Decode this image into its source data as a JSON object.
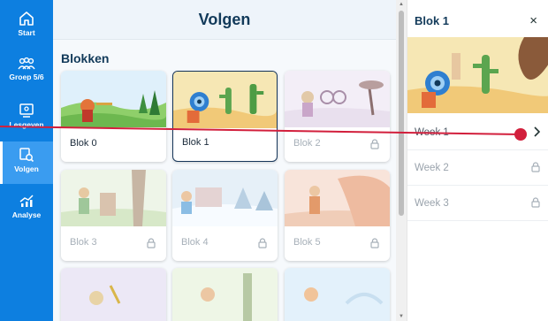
{
  "sidebar": {
    "items": [
      {
        "label": "Start",
        "icon": "home-icon"
      },
      {
        "label": "Groep 5/6",
        "icon": "group-icon"
      },
      {
        "label": "Lesgeven",
        "icon": "teach-icon"
      },
      {
        "label": "Volgen",
        "icon": "track-icon",
        "active": true
      },
      {
        "label": "Analyse",
        "icon": "chart-icon"
      }
    ]
  },
  "main": {
    "title": "Volgen",
    "section_title": "Blokken",
    "blocks": [
      {
        "label": "Blok 0",
        "locked": false,
        "selected": false
      },
      {
        "label": "Blok 1",
        "locked": false,
        "selected": true
      },
      {
        "label": "Blok 2",
        "locked": true,
        "selected": false
      },
      {
        "label": "Blok 3",
        "locked": true,
        "selected": false
      },
      {
        "label": "Blok 4",
        "locked": true,
        "selected": false
      },
      {
        "label": "Blok 5",
        "locked": true,
        "selected": false
      }
    ]
  },
  "panel": {
    "title": "Blok 1",
    "close_label": "×",
    "weeks": [
      {
        "label": "Week 1",
        "locked": false
      },
      {
        "label": "Week 2",
        "locked": true
      },
      {
        "label": "Week 3",
        "locked": true
      }
    ]
  },
  "colors": {
    "sidebar": "#0d7fe0",
    "heading": "#123a5a",
    "annotation": "#d21f3c"
  }
}
